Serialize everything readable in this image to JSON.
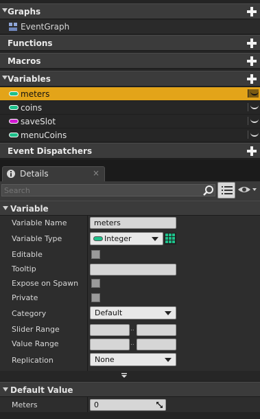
{
  "sections": {
    "graphs": "Graphs",
    "functions": "Functions",
    "macros": "Macros",
    "variables": "Variables",
    "dispatchers": "Event Dispatchers"
  },
  "event_graph": "EventGraph",
  "variables": [
    {
      "name": "meters",
      "color": "#1ec08a",
      "selected": true
    },
    {
      "name": "coins",
      "color": "#1ec08a",
      "selected": false
    },
    {
      "name": "saveSlot",
      "color": "#d21bd2",
      "selected": false
    },
    {
      "name": "menuCoins",
      "color": "#1ec08a",
      "selected": false
    }
  ],
  "details": {
    "tab": "Details",
    "search_placeholder": "Search",
    "variable_section": "Variable",
    "default_section": "Default Value",
    "labels": {
      "name": "Variable Name",
      "type": "Variable Type",
      "editable": "Editable",
      "tooltip": "Tooltip",
      "expose": "Expose on Spawn",
      "private": "Private",
      "category": "Category",
      "slider": "Slider Range",
      "value": "Value Range",
      "replication": "Replication",
      "meters": "Meters"
    },
    "values": {
      "name": "meters",
      "type": "Integer",
      "tooltip": "",
      "category": "Default",
      "replication": "None",
      "meters": "0"
    },
    "range_separator": ".."
  },
  "colors": {
    "accent": "#e3a419",
    "integer": "#1ec08a",
    "string": "#d21bd2"
  }
}
